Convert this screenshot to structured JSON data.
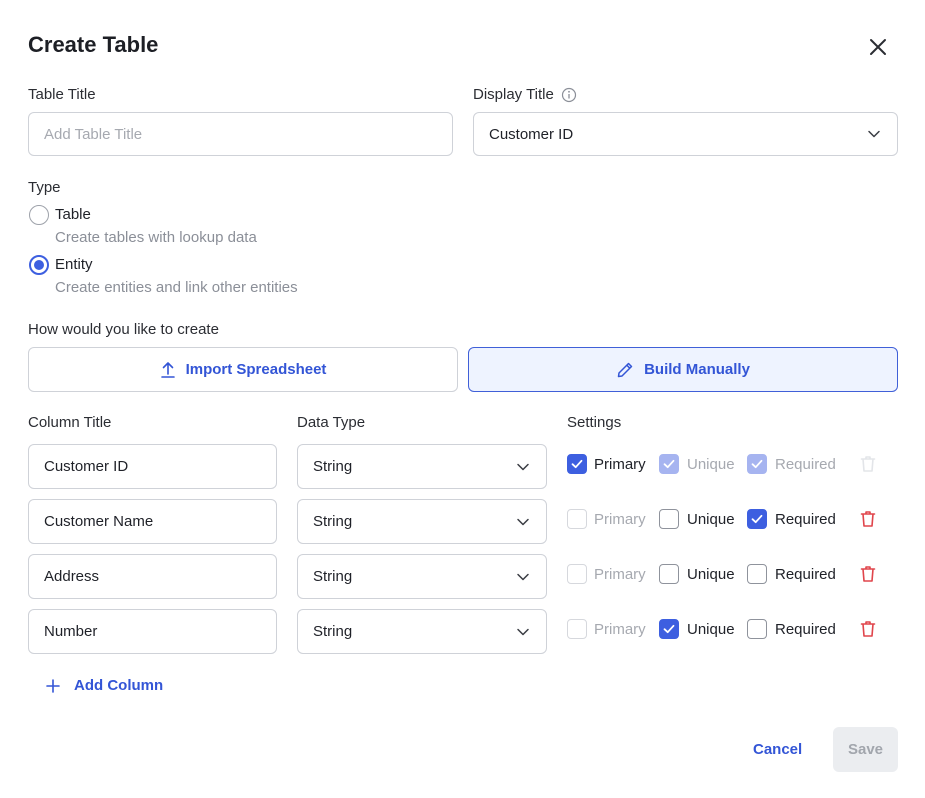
{
  "dialog": {
    "title": "Create Table"
  },
  "fields": {
    "table_title": {
      "label": "Table Title",
      "value": "",
      "placeholder": "Add Table Title"
    },
    "display_title": {
      "label": "Display Title",
      "value": "Customer ID"
    }
  },
  "type": {
    "label": "Type",
    "options": [
      {
        "label": "Table",
        "description": "Create tables with lookup data",
        "selected": false
      },
      {
        "label": "Entity",
        "description": "Create entities and link other entities",
        "selected": true
      }
    ]
  },
  "create_method": {
    "label": "How would you like to create",
    "options": [
      {
        "label": "Import Spreadsheet",
        "icon": "upload-icon",
        "active": false
      },
      {
        "label": "Build Manually",
        "icon": "pencil-icon",
        "active": true
      }
    ]
  },
  "columns": {
    "headers": {
      "title": "Column Title",
      "data_type": "Data Type",
      "settings": "Settings"
    },
    "setting_labels": {
      "primary": "Primary",
      "unique": "Unique",
      "required": "Required"
    },
    "rows": [
      {
        "title": "Customer ID",
        "data_type": "String",
        "primary": true,
        "unique": true,
        "required": true,
        "primary_disabled": false,
        "locked": true
      },
      {
        "title": "Customer Name",
        "data_type": "String",
        "primary": false,
        "unique": false,
        "required": true,
        "primary_disabled": true,
        "locked": false
      },
      {
        "title": "Address",
        "data_type": "String",
        "primary": false,
        "unique": false,
        "required": false,
        "primary_disabled": true,
        "locked": false
      },
      {
        "title": "Number",
        "data_type": "String",
        "primary": false,
        "unique": true,
        "required": false,
        "primary_disabled": true,
        "locked": false
      }
    ],
    "add_label": "Add Column"
  },
  "footer": {
    "cancel": "Cancel",
    "save": "Save"
  },
  "colors": {
    "accent": "#3d5fe0",
    "danger": "#e0454b",
    "link": "#3355d6"
  }
}
